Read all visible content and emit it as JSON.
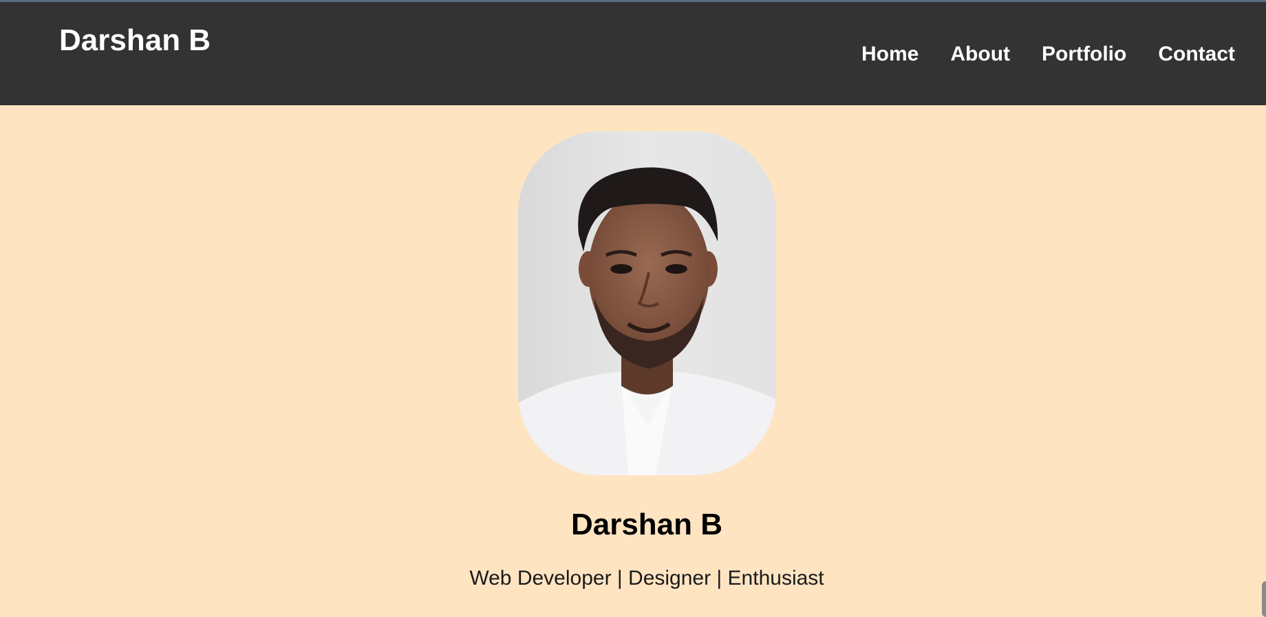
{
  "header": {
    "brand": "Darshan B",
    "nav": [
      {
        "label": "Home"
      },
      {
        "label": "About"
      },
      {
        "label": "Portfolio"
      },
      {
        "label": "Contact"
      }
    ]
  },
  "hero": {
    "photo_icon": "profile-photo",
    "name": "Darshan B",
    "tagline": "Web Developer | Designer | Enthusiast"
  },
  "colors": {
    "header_bg": "#333333",
    "page_bg": "#ffe4c2",
    "text_light": "#ffffff",
    "text_dark": "#000000"
  }
}
